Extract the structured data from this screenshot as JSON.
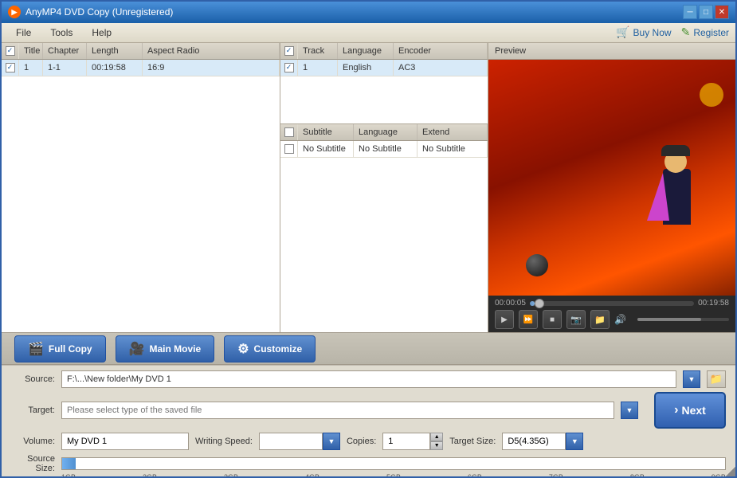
{
  "titleBar": {
    "title": "AnyMP4 DVD Copy (Unregistered)",
    "appIcon": "●",
    "controls": [
      "─",
      "□",
      "✕"
    ]
  },
  "menuBar": {
    "items": [
      "File",
      "Tools",
      "Help"
    ],
    "right": [
      {
        "icon": "🛒",
        "label": "Buy Now"
      },
      {
        "icon": "✎",
        "label": "Register"
      }
    ]
  },
  "videoTable": {
    "headers": [
      "",
      "Title",
      "Chapter",
      "Length",
      "Aspect Radio"
    ],
    "rows": [
      {
        "checked": true,
        "title": "1",
        "chapter": "1-1",
        "length": "00:19:58",
        "aspect": "16:9"
      }
    ]
  },
  "audioTable": {
    "headers": [
      "",
      "Track",
      "Language",
      "Encoder"
    ],
    "rows": [
      {
        "checked": true,
        "track": "1",
        "language": "English",
        "encoder": "AC3"
      }
    ]
  },
  "subtitleTable": {
    "headers": [
      "",
      "Subtitle",
      "Language",
      "Extend"
    ],
    "rows": [
      {
        "checked": false,
        "subtitle": "No Subtitle",
        "language": "No Subtitle",
        "extend": "No Subtitle"
      }
    ]
  },
  "preview": {
    "label": "Preview",
    "timeStart": "00:00:05",
    "timeEnd": "00:19:58"
  },
  "toolbar": {
    "buttons": [
      {
        "icon": "🎬",
        "label": "Full Copy"
      },
      {
        "icon": "🎥",
        "label": "Main Movie"
      },
      {
        "icon": "⚙",
        "label": "Customize"
      }
    ]
  },
  "source": {
    "label": "Source:",
    "value": "F:\\...\\New folder\\My DVD 1",
    "placeholder": "F:\\...\\New folder\\My DVD 1"
  },
  "target": {
    "label": "Target:",
    "value": "",
    "placeholder": "Please select type of the saved file"
  },
  "volume": {
    "label": "Volume:",
    "value": "My DVD 1"
  },
  "writingSpeed": {
    "label": "Writing Speed:",
    "value": ""
  },
  "copies": {
    "label": "Copies:",
    "value": "1"
  },
  "targetSize": {
    "label": "Target Size:",
    "value": "D5(4.35G)"
  },
  "sourceSize": {
    "label": "Source Size:",
    "markers": [
      "1GB",
      "2GB",
      "3GB",
      "4GB",
      "5GB",
      "6GB",
      "7GB",
      "8GB",
      "9GB"
    ]
  },
  "nextButton": {
    "label": "Next",
    "chevron": "›"
  }
}
